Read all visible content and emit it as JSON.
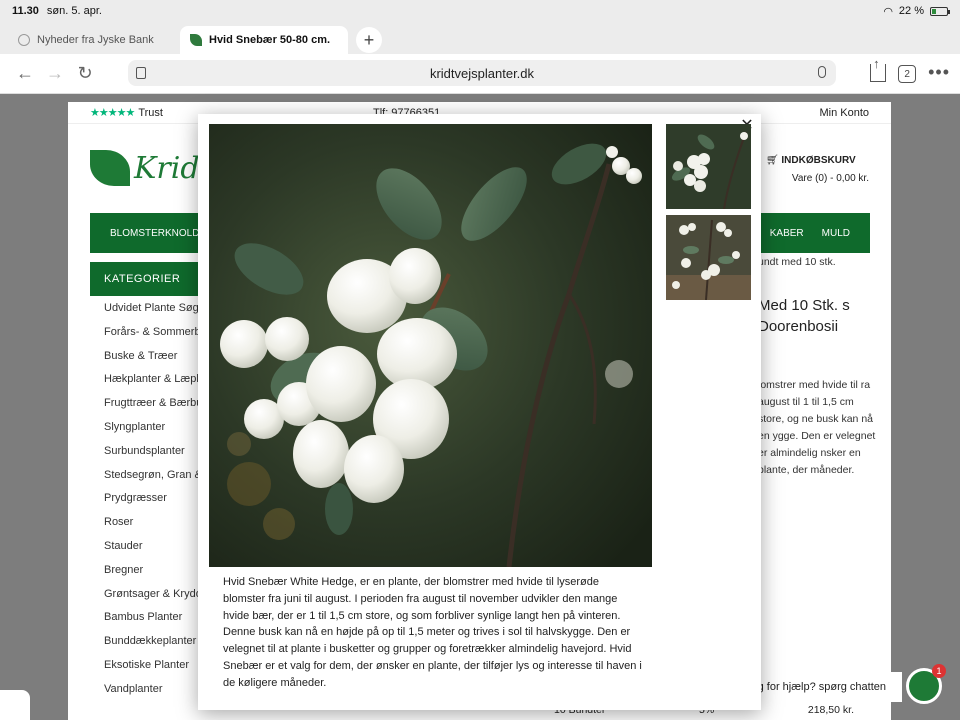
{
  "status": {
    "time": "11.30",
    "date": "søn. 5. apr.",
    "battery_percent": "22 %",
    "battery_level": 0.22
  },
  "tabs": [
    {
      "label": "Nyheder fra Jyske Bank",
      "active": false,
      "icon": "globe-icon"
    },
    {
      "label": "Hvid Snebær 50-80 cm.",
      "active": true,
      "icon": "leaf-icon"
    }
  ],
  "nav": {
    "url": "kridtvejsplanter.dk",
    "tab_count": "2"
  },
  "site": {
    "trustpilot": "Trust",
    "phone": "Tlf: 97766351",
    "account": "Min Konto",
    "logo_text": "Kridt",
    "cart_title": "INDKØBSKURV",
    "cart_summary": "Vare (0) - 0,00 kr.",
    "menu_left": "BLOMSTERKNOLDE",
    "menu_right": [
      "KABER",
      "MULD"
    ],
    "categories_title": "KATEGORIER",
    "categories": [
      "Udvidet Plante Søg",
      "Forårs- & Sommerb",
      "Buske & Træer",
      "Hækplanter & Læpl",
      "Frugttræer & Bærbu",
      "Slyngplanter",
      "Surbundsplanter",
      "Stedsegrøn, Gran &",
      "Prydgræsser",
      "Roser",
      "Stauder",
      "Bregner",
      "Grøntsager & Krydo",
      "Bambus Planter",
      "Bunddækkeplanter",
      "Eksotiske Planter",
      "Vandplanter"
    ],
    "right_snippet": "undt med 10 stk.",
    "right_heading": "Med 10 Stk. s Doorenbosii",
    "right_text": "lomstrer med hvide til ra august til 1 til 1,5 cm store, og ne busk kan nå en ygge. Den er velegnet er almindelig nsker en plante, der måneder.",
    "price_row": {
      "qty": "10 Bundter",
      "discount": "5%",
      "price": "218,50 kr."
    },
    "help_text": "g for hjælp? spørg chatten",
    "chat_badge": "1"
  },
  "modal": {
    "description": "Hvid Snebær White Hedge, er en plante, der blomstrer med hvide til lyserøde blomster fra juni til august. I perioden fra august til november udvikler den mange hvide bær, der er 1 til 1,5 cm store, og som forbliver synlige langt hen på vinteren. Denne busk kan nå en højde på op til 1,5 meter og trives i sol til halvskygge. Den er velegnet til at plante i busketter og grupper og foretrækker almindelig havejord. Hvid Snebær er et valg for dem, der ønsker en plante, der tilføjer lys og interesse til haven i de køligere måneder."
  },
  "colors": {
    "brand_green": "#0f6a2c",
    "trustpilot_green": "#00b67a"
  }
}
